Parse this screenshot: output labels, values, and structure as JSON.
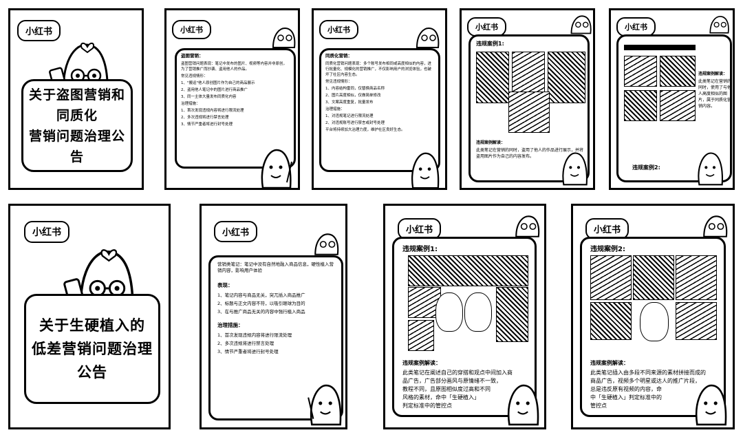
{
  "brand": "小红书",
  "cover1": {
    "title_line1": "关于盗图营销和同质化",
    "title_line2": "营销问题治理公告"
  },
  "cover2": {
    "title_line1": "关于生硬植入的",
    "title_line2": "低差营销问题治理公告"
  },
  "page2": {
    "heading": "盗图营销：",
    "paragraphs": [
      "盗图营销问题表现：笔记中发布的图片、视频等内容并非原创，为了营销推广而抄袭、盗用他人的作品。",
      "常见违规情形：",
      "1、\"搬运\"他人原创图片作为自己的商品展示",
      "2、盗用他人笔记中的图片进行商品推广",
      "3、同一主体大量发布同质化内容",
      "治理措施：",
      "1、首次发现违规内容将进行限流处理",
      "2、多次违规将进行禁言处理",
      "3、情节严重者将进行封号处理"
    ]
  },
  "page3": {
    "heading": "同质化营销：",
    "paragraphs": [
      "同质化营销问题表现：多个账号发布相同或高度相似的内容，进行批量化、规模化的营销推广，不仅影响用户的浏览体验，也破坏了社区内容生态。",
      "常见违规情形：",
      "1、内容结构雷同，仅替换商品名称",
      "2、图片高度相似，仅做简单修改",
      "3、文案高度重复，批量发布",
      "治理措施：",
      "1、对违规笔记进行限流处理",
      "2、对违规账号进行禁言或封号处理",
      "平台将持续加大治理力度，维护社区良好生态。"
    ]
  },
  "page4": {
    "label": "违规案例1:",
    "desc_title": "违规案例解读：",
    "desc": "此类笔记在营销的同时，盗用了他人的作品进行展示，并将盗用图片作为自己的内容发布。"
  },
  "page5": {
    "desc_title": "违规案例解读：",
    "desc": "此类笔记在营销的同时，使用了与他人高度相似的图片，属于同质化营销内容。",
    "label": "违规案例2:"
  },
  "page6": {
    "intro": "营销类笔记：笔记中没有自然地融入商品信息，硬性植入营销内容，影响用户体验",
    "section1_title": "表现：",
    "section1": [
      "1、笔记内容与商品无关，突兀插入商品推广",
      "2、标题与正文内容不符，以吸引眼球为目的",
      "3、在与推广商品无关的内容中强行植入商品"
    ],
    "section2_title": "治理措施：",
    "section2": [
      "1、首次发现违规内容将进行限流处理",
      "2、多次违规将进行禁言处理",
      "3、情节严重者将进行封号处理"
    ]
  },
  "page7": {
    "label": "违规案例1:",
    "desc_title": "违规案例解读：",
    "desc_lines": [
      "此类笔记在阐述自己的穿搭和观点中间加入商",
      "品广告，广告部分画风与原情绪不一致，",
      "教程不同，且原图相似度过高和不同",
      "风格的素材，命中「生硬植入」",
      "判定标准中的管控点"
    ]
  },
  "page8": {
    "label": "违规案例2:",
    "desc_title": "违规案例解读：",
    "desc_lines": [
      "此类笔记插入由多段不同来源的素材拼接而成的",
      "商品广告，视频多个明星或达人的推广片段，",
      "总是违反原有视频的内容，命",
      "中「生硬植入」判定标准中的",
      "管控点"
    ]
  }
}
